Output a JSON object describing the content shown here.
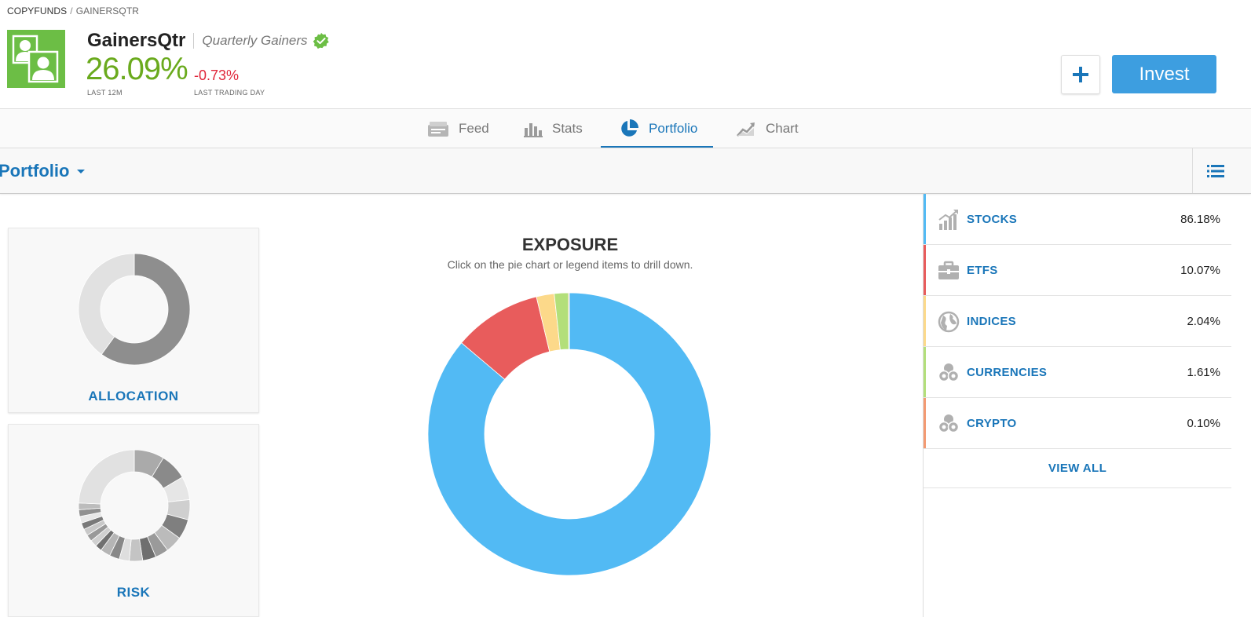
{
  "breadcrumb": {
    "root": "COPYFUNDS",
    "separator": "/",
    "current": "GAINERSQTR"
  },
  "fund": {
    "name": "GainersQtr",
    "subtitle": "Quarterly Gainers",
    "gain": "26.09%",
    "gain_label": "LAST 12M",
    "day_change": "-0.73%",
    "day_label": "LAST TRADING DAY"
  },
  "actions": {
    "plus": "+",
    "invest": "Invest"
  },
  "tabs": [
    {
      "label": "Feed",
      "icon": "feed-icon",
      "active": false
    },
    {
      "label": "Stats",
      "icon": "stats-icon",
      "active": false
    },
    {
      "label": "Portfolio",
      "icon": "pie-icon",
      "active": true
    },
    {
      "label": "Chart",
      "icon": "chart-icon",
      "active": false
    }
  ],
  "portfolio_bar": {
    "title": "Portfolio"
  },
  "cards": {
    "allocation": "ALLOCATION",
    "risk": "RISK"
  },
  "exposure": {
    "title": "EXPOSURE",
    "subtitle": "Click on the pie chart or legend items to drill down."
  },
  "legend": {
    "items": [
      {
        "name": "STOCKS",
        "value": "86.18%",
        "color": "#52baf4",
        "icon": "stocks-icon"
      },
      {
        "name": "ETFS",
        "value": "10.07%",
        "color": "#e85c5c",
        "icon": "briefcase-icon"
      },
      {
        "name": "INDICES",
        "value": "2.04%",
        "color": "#fcd98a",
        "icon": "globe-icon"
      },
      {
        "name": "CURRENCIES",
        "value": "1.61%",
        "color": "#b3df7a",
        "icon": "coins-icon"
      },
      {
        "name": "CRYPTO",
        "value": "0.10%",
        "color": "#f39a72",
        "icon": "coins-icon"
      }
    ],
    "view_all": "VIEW ALL"
  },
  "chart_data": {
    "type": "pie",
    "categories": [
      "STOCKS",
      "ETFS",
      "INDICES",
      "CURRENCIES",
      "CRYPTO"
    ],
    "values": [
      86.18,
      10.07,
      2.04,
      1.61,
      0.1
    ],
    "colors": [
      "#52baf4",
      "#e85c5c",
      "#fcd98a",
      "#b3df7a",
      "#f39a72"
    ],
    "title": "EXPOSURE",
    "donut": true
  },
  "allocation_chart": {
    "values": [
      60,
      40
    ],
    "colors": [
      "#8e8e8e",
      "#e1e1e1"
    ]
  },
  "risk_chart": {
    "values": [
      9,
      8,
      7,
      6,
      6,
      5,
      4,
      4,
      4,
      3,
      3,
      3,
      2,
      2,
      2,
      2,
      2,
      2,
      2,
      2,
      25
    ],
    "colors": [
      "#aaaaaa",
      "#8a8a8a",
      "#e6e6e6",
      "#cfcfcf",
      "#7f7f7f",
      "#bbbbbb",
      "#9a9a9a",
      "#6f6f6f",
      "#c4c4c4",
      "#dedede",
      "#888888",
      "#b5b5b5",
      "#707070",
      "#d0d0d0",
      "#999999",
      "#c8c8c8",
      "#7a7a7a",
      "#e8e8e8",
      "#909090",
      "#bcbcbc",
      "#e1e1e1"
    ]
  }
}
